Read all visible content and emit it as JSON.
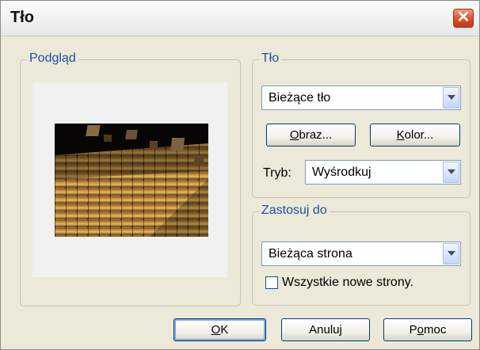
{
  "dialog": {
    "title": "Tło"
  },
  "preview_group": {
    "legend": "Podgląd"
  },
  "background_group": {
    "legend": "Tło",
    "background_select": "Bieżące tło",
    "image_button": "Obraz...",
    "image_button_accel": "O",
    "image_button_rest": "braz...",
    "color_button": "Kolor...",
    "color_button_accel": "K",
    "color_button_rest": "olor...",
    "mode_label": "Tryb:",
    "mode_select": "Wyśrodkuj"
  },
  "apply_group": {
    "legend": "Zastosuj do",
    "apply_select": "Bieżąca strona",
    "all_pages_checkbox": "Wszystkie nowe strony.",
    "all_pages_checked": false
  },
  "footer": {
    "ok": "OK",
    "ok_accel": "O",
    "ok_rest": "K",
    "cancel": "Anuluj",
    "help": "Pomoc",
    "help_pre": "P",
    "help_accel": "o",
    "help_rest": "moc"
  },
  "icons": {
    "close": "close-icon",
    "dropdown": "chevron-down-icon"
  },
  "colors": {
    "legend": "#1f4ea8",
    "close_button": "#d9502a",
    "dialog_bg": "#ece9d8"
  }
}
